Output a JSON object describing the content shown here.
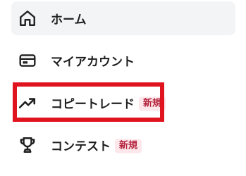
{
  "nav": {
    "items": [
      {
        "label": "ホーム",
        "icon": "home-icon",
        "active": true,
        "badge": ""
      },
      {
        "label": "マイアカウント",
        "icon": "card-icon",
        "active": false,
        "badge": ""
      },
      {
        "label": "コピートレード",
        "icon": "trending-up-icon",
        "active": false,
        "badge": "新規"
      },
      {
        "label": "コンテスト",
        "icon": "trophy-icon",
        "active": false,
        "badge": "新規"
      }
    ]
  },
  "colors": {
    "active_bg": "#f3f4f6",
    "text": "#1f1f1f",
    "badge_bg": "#fde7ea",
    "badge_text": "#b4233c",
    "highlight": "#e0141e"
  }
}
